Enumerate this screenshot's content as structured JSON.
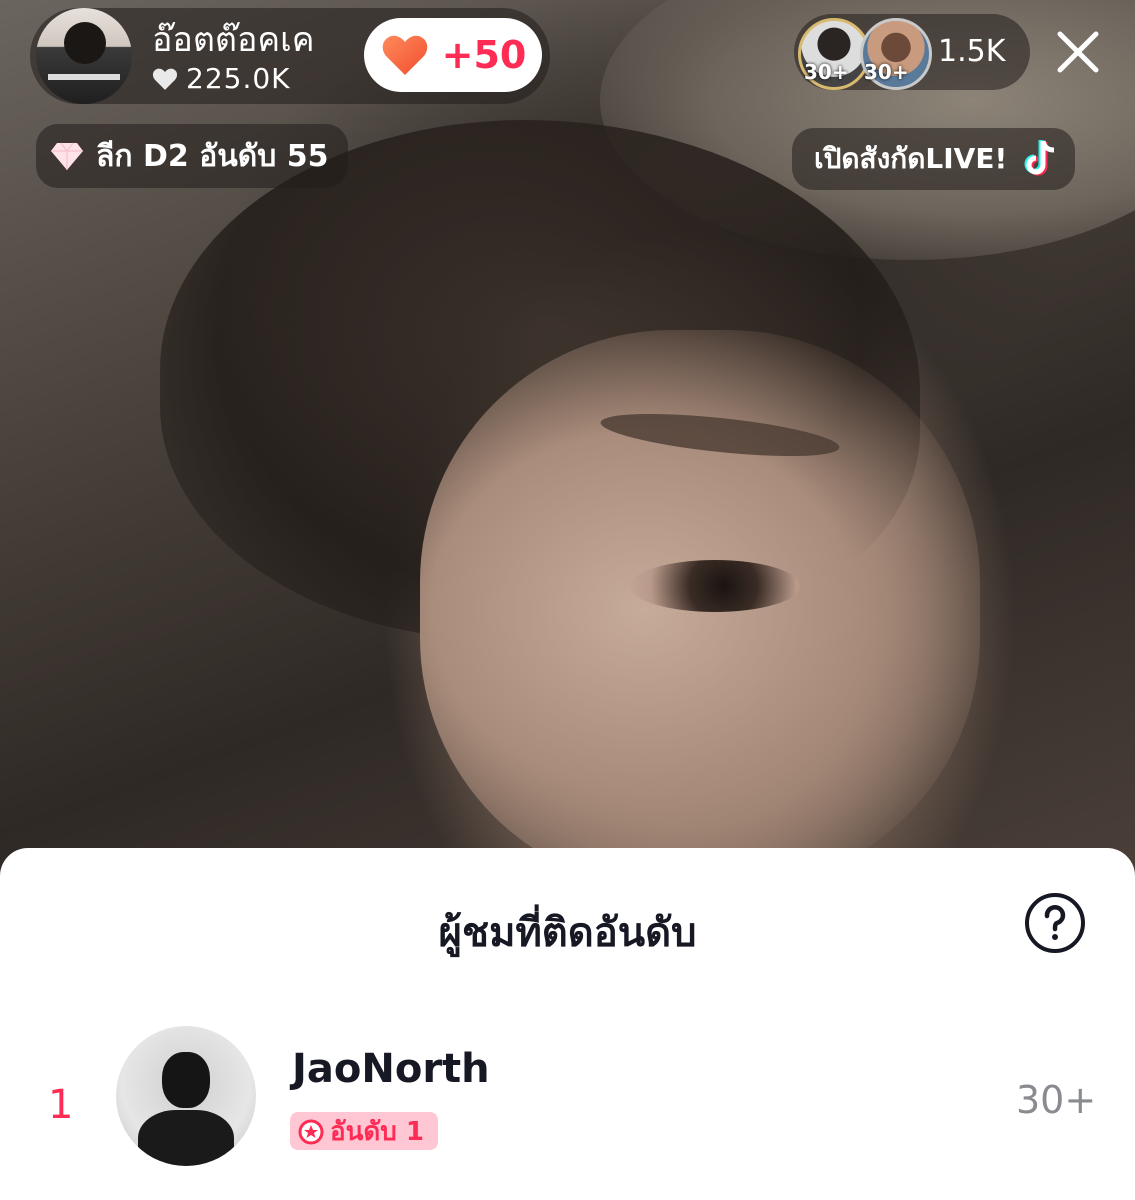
{
  "host": {
    "name": "อ๊อตต๊อคเค",
    "likes": "225.0K",
    "plus_label": "+50"
  },
  "league": {
    "label": "ลีก D2 อันดับ 55"
  },
  "viewers": {
    "avatar_badges": [
      "30+",
      "30+"
    ],
    "count": "1.5K"
  },
  "subscribe": {
    "label": "เปิดสังกัดLIVE!"
  },
  "ranking": {
    "title": "ผู้ชมที่ติดอันดับ",
    "entries": [
      {
        "rank": "1",
        "name": "JaoNorth",
        "badge": "อันดับ 1",
        "score": "30+"
      }
    ]
  },
  "colors": {
    "accent": "#fe2c55",
    "badge_bg": "#ffc7d4",
    "sheet_bg": "#ffffff"
  }
}
